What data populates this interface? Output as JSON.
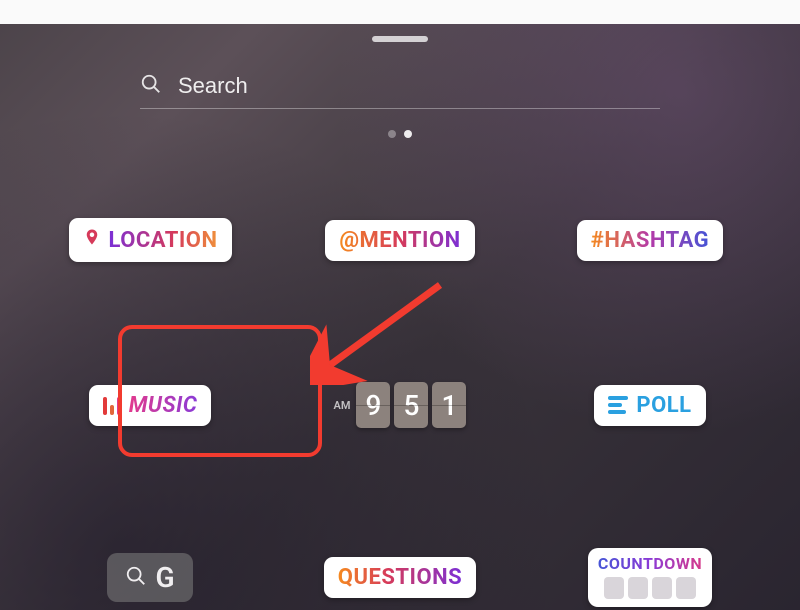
{
  "search": {
    "placeholder": "Search"
  },
  "pagination": {
    "pages": 2,
    "active_index": 1
  },
  "stickers": {
    "location": {
      "label": "LOCATION"
    },
    "mention": {
      "label": "@MENTION"
    },
    "hashtag": {
      "label": "#HASHTAG"
    },
    "music": {
      "label": "MUSIC"
    },
    "time": {
      "ampm": "AM",
      "digits": [
        "9",
        "5",
        "1"
      ]
    },
    "poll": {
      "label": "POLL"
    },
    "gif": {
      "label": "G"
    },
    "questions": {
      "label": "QUESTIONS"
    },
    "countdown": {
      "label": "COUNTDOWN"
    }
  },
  "annotation": {
    "highlighted_sticker": "music"
  }
}
